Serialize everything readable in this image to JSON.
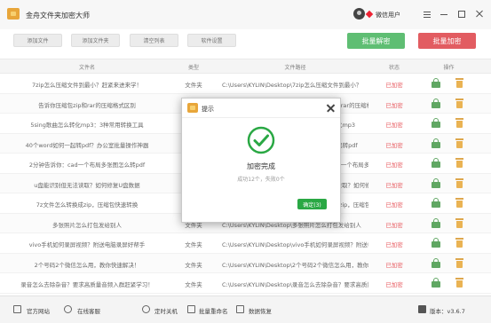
{
  "app": {
    "title": "金舟文件夹加密大师",
    "user_name": "微信用户"
  },
  "toolbar": {
    "add_file": "添加文件",
    "add_folder": "添加文件夹",
    "clear_list": "清空列表",
    "settings": "软件设置",
    "batch_decrypt": "批量解密",
    "batch_encrypt": "批量加密"
  },
  "table": {
    "headers": {
      "name": "文件名",
      "type": "类型",
      "path": "文件路径",
      "status": "状态",
      "actions": "操作"
    },
    "rows": [
      {
        "name": "7zip怎么压缩文件到最小？赶紧来进来学！",
        "type": "文件夹",
        "path": "C:\\Users\\KYLIN\\Desktop\\7zip怎么压缩文件到最小？",
        "status": "已加密"
      },
      {
        "name": "告诉你压缩包zip和rar的压缩格式区别",
        "type": "文件夹",
        "path": "C:\\Users\\KYLIN\\Desktop\\告诉你压缩包zip和rar的压缩格式区别",
        "status": "已加密"
      },
      {
        "name": "5sing歌曲怎么转化mp3：3种常用转换工具",
        "type": "文件夹",
        "path": "C:\\Users\\KYLIN\\Desktop\\5sing歌曲怎么转化mp3",
        "status": "已加密"
      },
      {
        "name": "40个word如何一起转pdf？办公室批量操作神器",
        "type": "文件夹",
        "path": "C:\\Users\\KYLIN\\Desktop\\40个word如何一起转pdf",
        "status": "已加密"
      },
      {
        "name": "2分钟告诉你：cad一个布局多张图怎么转pdf",
        "type": "文件夹",
        "path": "C:\\Users\\KYLIN\\Desktop\\2分钟告诉你：cad一个布局多张图怎么转pdf",
        "status": "已加密"
      },
      {
        "name": "u盘能识别但无法读取？如何修复U盘数据",
        "type": "文件夹",
        "path": "C:\\Users\\KYLIN\\Desktop\\u盘能识别但无法读取？如何修复U盘数据",
        "status": "已加密"
      },
      {
        "name": "7z文件怎么转换成zip，压缩包快速转换",
        "type": "文件夹",
        "path": "C:\\Users\\KYLIN\\Desktop\\7z文件怎么转换成zip，压缩包快速转换",
        "status": "已加密"
      },
      {
        "name": "多张照片怎么打包发给别人",
        "type": "文件夹",
        "path": "C:\\Users\\KYLIN\\Desktop\\多张照片怎么打包发给别人",
        "status": "已加密"
      },
      {
        "name": "vivo手机如何录屏视频？附送电脑录屏好帮手",
        "type": "文件夹",
        "path": "C:\\Users\\KYLIN\\Desktop\\vivo手机如何录屏视频？附送电脑录屏好帮手",
        "status": "已加密"
      },
      {
        "name": "2个号码2个微信怎么用，教你快速解决！",
        "type": "文件夹",
        "path": "C:\\Users\\KYLIN\\Desktop\\2个号码2个微信怎么用，教你快速解决！",
        "status": "已加密"
      },
      {
        "name": "录音怎么去除杂音？要求高质量音频入群赶紧学习！",
        "type": "文件夹",
        "path": "C:\\Users\\KYLIN\\Desktop\\录音怎么去除杂音？要求高质量音频入群赶紧学习！",
        "status": "已加密"
      }
    ]
  },
  "dialog": {
    "title": "提示",
    "main": "加密完成",
    "detail": "成功12个，失败0个",
    "ok": "确定(3)"
  },
  "footer": {
    "website": "官方网站",
    "service": "在线客服",
    "timer": "定时关机",
    "rename": "批量重命名",
    "recover": "数据恢复",
    "version": "版本：v3.6.7"
  },
  "colors": {
    "green": "#2aa844",
    "red": "#d9262d",
    "status_red": "#e0262d"
  }
}
